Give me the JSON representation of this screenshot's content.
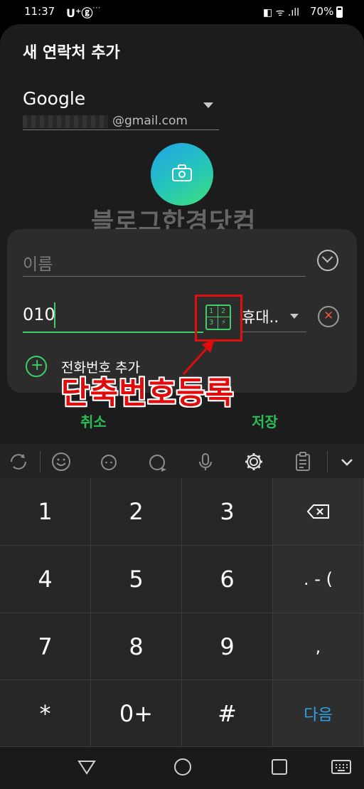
{
  "status_bar": {
    "time": "11:37",
    "carrier": "U⁺ⓖ",
    "more": "···",
    "system_icons": "◧ ᯤ .ıll",
    "battery": "70%"
  },
  "dialog": {
    "title": "새 연락처 추가",
    "account": {
      "name": "Google",
      "email_suffix": "@gmail.com"
    },
    "watermark": "블로그한경닷컴",
    "fields": {
      "name_placeholder": "이름",
      "phone_value": "010",
      "phone_type": "휴대..",
      "speed_dial_digits": [
        "1",
        "2",
        "3",
        "⚡"
      ],
      "add_phone_label": "전화번호 추가"
    },
    "annotation": "단축번호등록",
    "cancel_label": "취소",
    "save_label": "저장"
  },
  "keypad": {
    "rows": [
      [
        "1",
        "2",
        "3",
        "⌫"
      ],
      [
        "4",
        "5",
        "6",
        ". - ("
      ],
      [
        "7",
        "8",
        "9",
        ","
      ],
      [
        "*",
        "0+",
        "#",
        "다음"
      ]
    ]
  },
  "colors": {
    "accent_green": "#3ecf6a",
    "annotation_red": "#e00c0c",
    "next_blue": "#2ea3e6"
  }
}
